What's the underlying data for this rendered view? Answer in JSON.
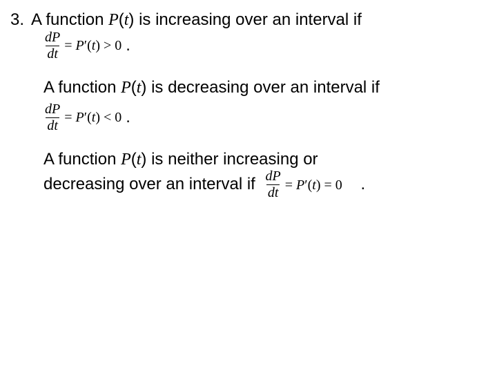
{
  "list_number": "3.",
  "p1_a": "A function ",
  "fn_name": "P",
  "fn_open": "(",
  "fn_arg": "t",
  "fn_close": ")",
  "p1_b": " is increasing over an interval if",
  "frac_num": "dP",
  "frac_den": "dt",
  "eq1_rhs_a": " = ",
  "eq1_rhs_b": "P",
  "eq1_rhs_prime": "′",
  "eq1_rhs_c": "(",
  "eq1_rhs_d": "t",
  "eq1_rhs_e": ") > 0",
  "dot": ".",
  "p2_a": "A function ",
  "p2_b": " is decreasing over an interval if",
  "eq2_rhs_e": ") < 0",
  "p3_a": "A function ",
  "p3_b": " is neither increasing or",
  "p3_c": "decreasing over an interval if ",
  "eq3_rhs_e": ") = 0",
  "trail_dot3": "."
}
